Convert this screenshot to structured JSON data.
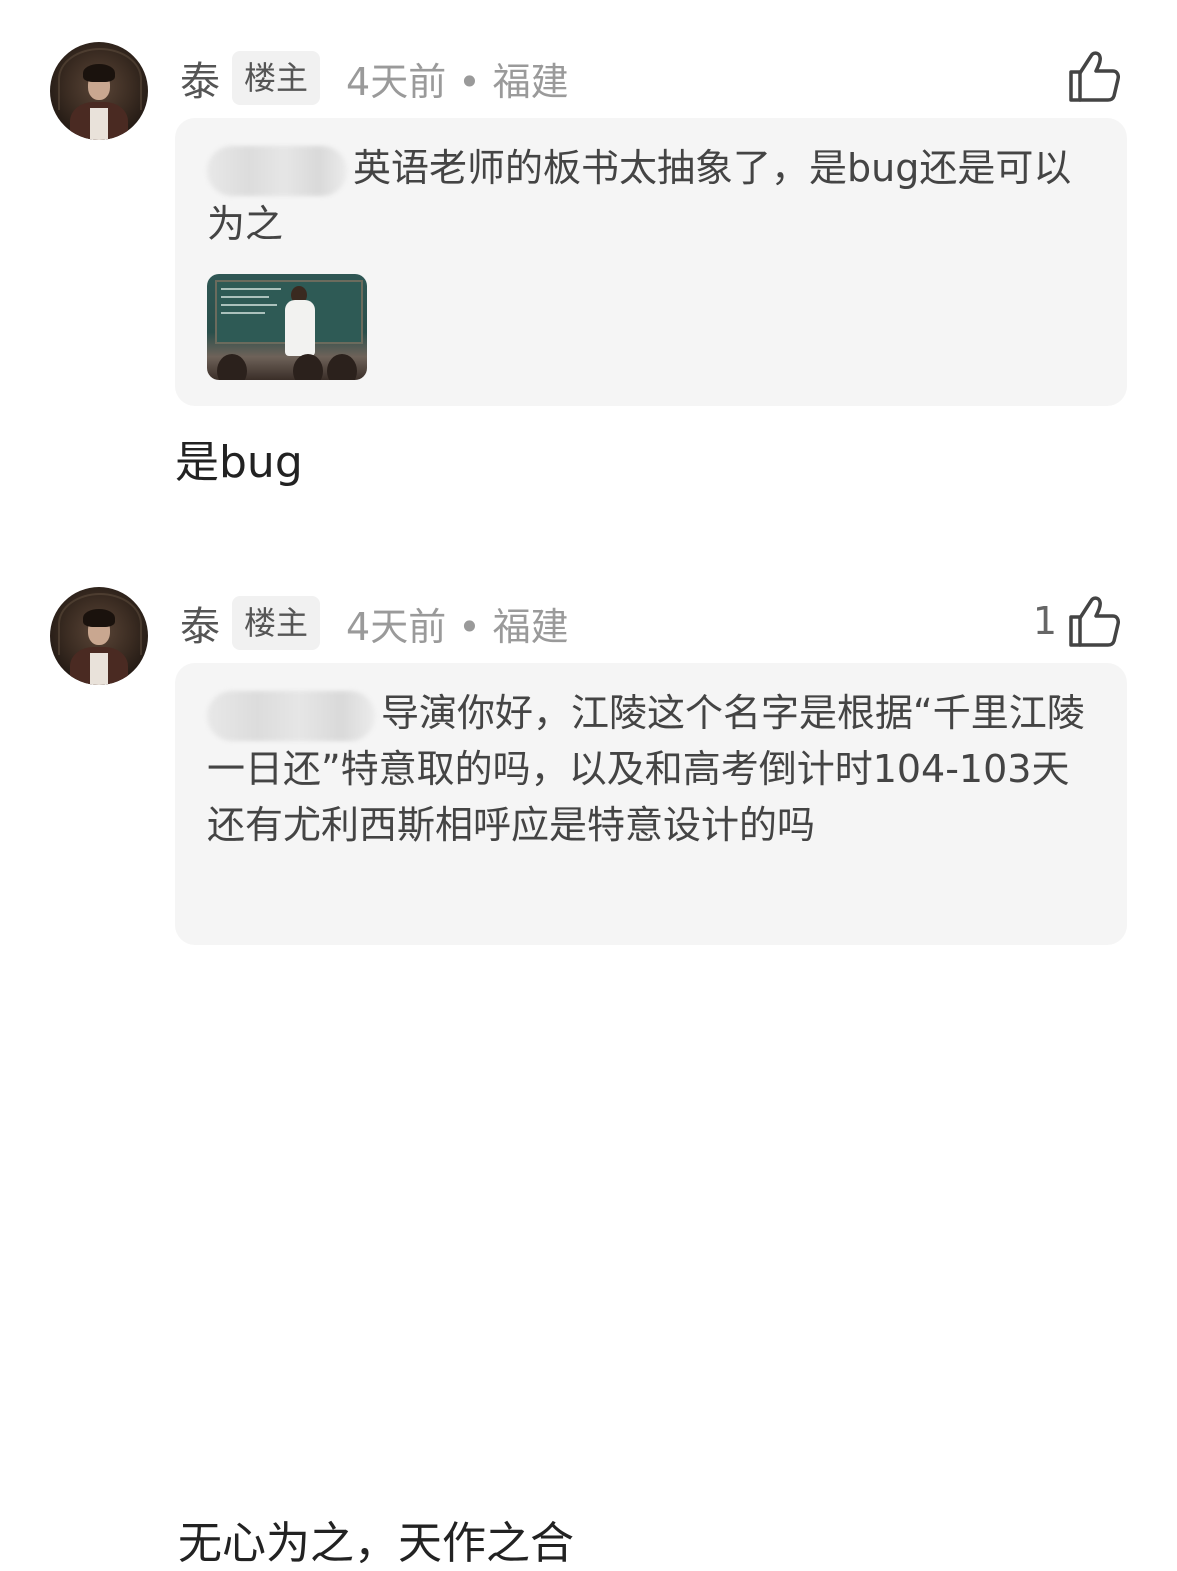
{
  "comments": [
    {
      "username": "泰",
      "badge": "楼主",
      "time": "4天前",
      "location": "福建",
      "separator": "•",
      "like_count": "",
      "quote": {
        "text": "英语老师的板书太抽象了，是bug还是可以为之",
        "has_image": true
      },
      "reply": "是bug"
    },
    {
      "username": "泰",
      "badge": "楼主",
      "time": "4天前",
      "location": "福建",
      "separator": "•",
      "like_count": "1",
      "quote": {
        "text": "导演你好，江陵这个名字是根据“千里江陵一日还”特意取的吗，以及和高考倒计时104-103天还有尤利西斯相呼应是特意设计的吗",
        "has_image": false
      },
      "reply": "无心为之，天作之合"
    }
  ],
  "icons": {
    "like": "thumbs-up-icon"
  },
  "colors": {
    "quote_bg": "#f5f5f5",
    "meta_text": "#9a9a9a",
    "badge_bg": "#f1f1f1"
  }
}
